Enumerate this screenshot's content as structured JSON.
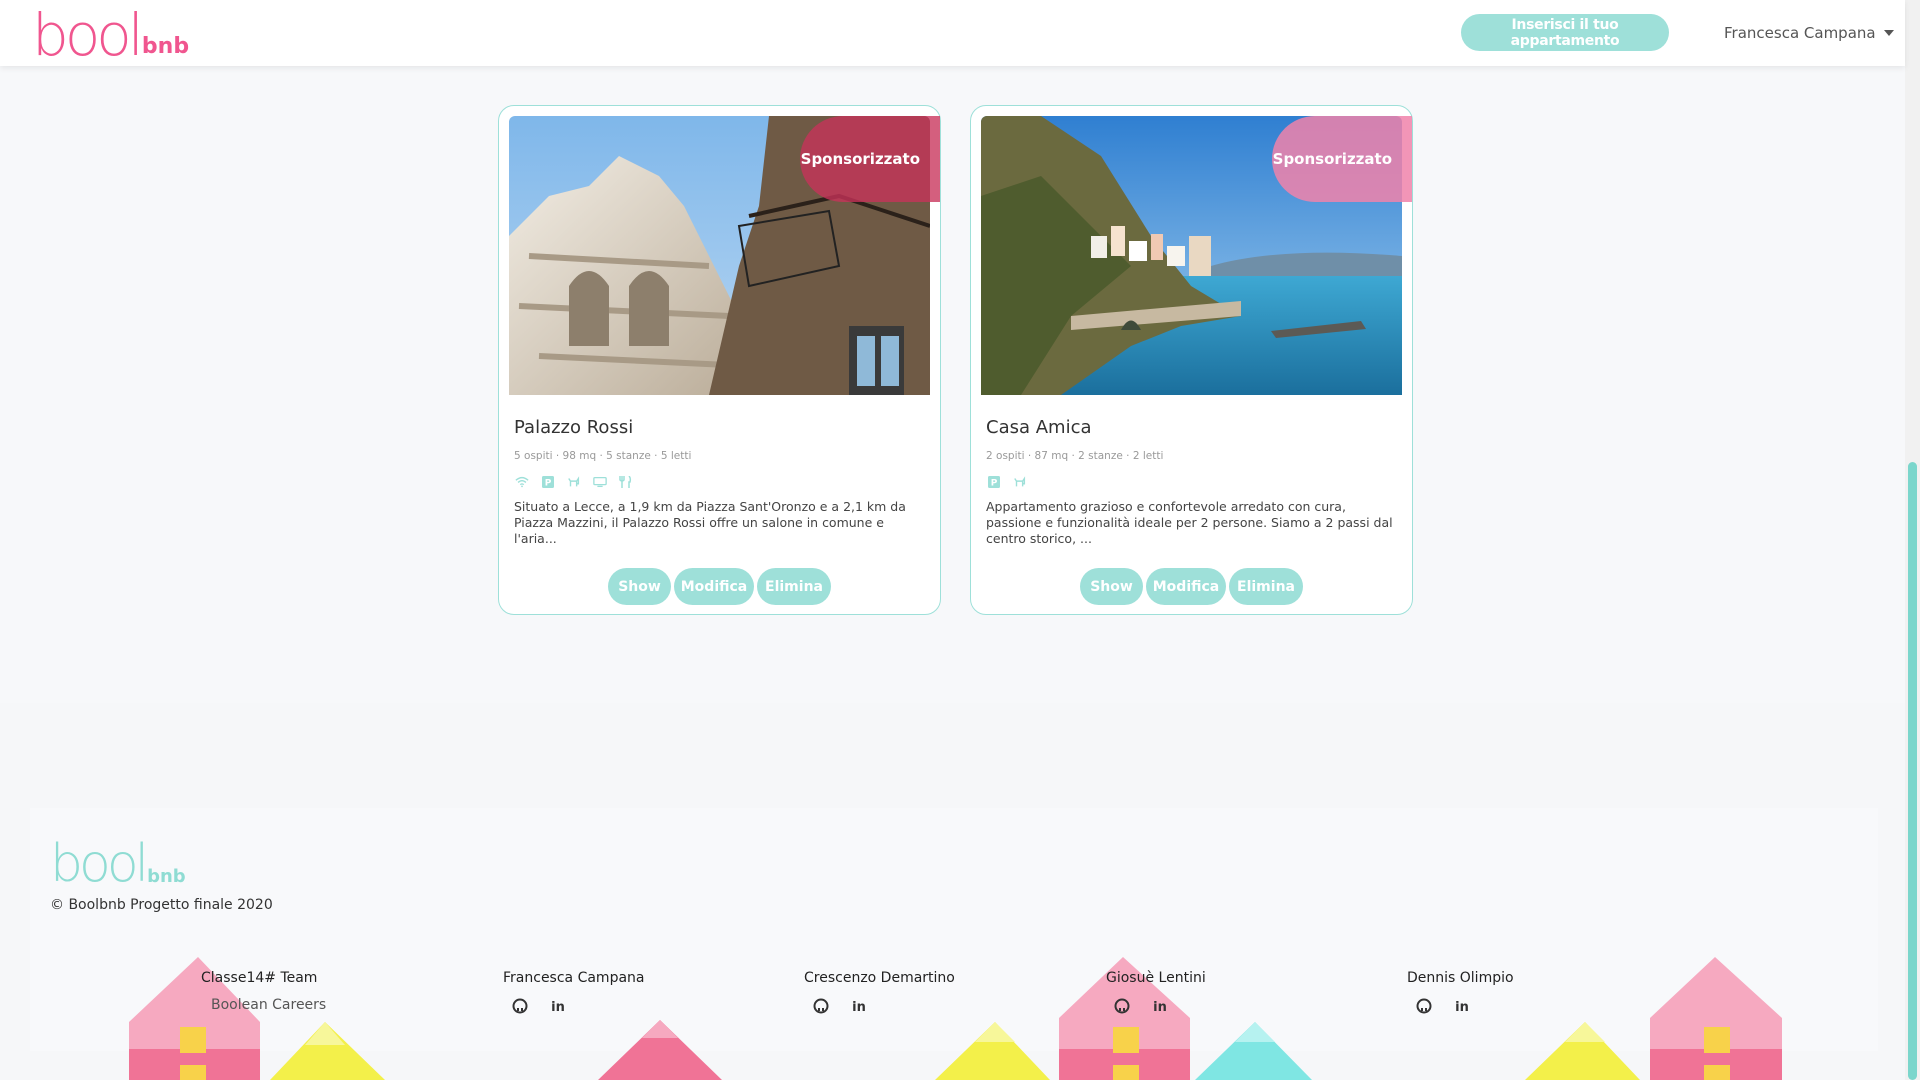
{
  "nav": {
    "logo_big": "bool",
    "logo_small": "bnb",
    "cta_label": "Inserisci il tuo appartamento",
    "user_name": "Francesca Campana"
  },
  "cards": [
    {
      "badge": "Sponsorizzato",
      "title": "Palazzo Rossi",
      "meta": "5 ospiti · 98 mq · 5 stanze · 5 letti",
      "amenities": [
        "wifi-icon",
        "parking-icon",
        "pets-icon",
        "tv-icon",
        "restaurant-icon"
      ],
      "description": "Situato a Lecce, a 1,9 km da Piazza Sant'Oronzo e a 2,1 km da Piazza Mazzini, il Palazzo Rossi offre un salone in comune e l'aria...",
      "actions": [
        "Show",
        "Modifica",
        "Elimina"
      ]
    },
    {
      "badge": "Sponsorizzato",
      "title": "Casa Amica",
      "meta": "2 ospiti · 87 mq · 2 stanze · 2 letti",
      "amenities": [
        "parking-icon",
        "pets-icon"
      ],
      "description": "Appartamento grazioso e confortevole arredato con cura, passione e funzionalità ideale per 2 persone. Siamo a 2 passi dal centro storico, ...",
      "actions": [
        "Show",
        "Modifica",
        "Elimina"
      ]
    }
  ],
  "footer": {
    "logo_big": "bool",
    "logo_small": "bnb",
    "copyright": "© Boolbnb Progetto finale 2020",
    "team": [
      {
        "name": "Classe14# Team",
        "sub": "Boolean Careers"
      },
      {
        "name": "Francesca Campana"
      },
      {
        "name": "Crescenzo Demartino"
      },
      {
        "name": "Giosuè Lentini"
      },
      {
        "name": "Dennis Olimpio"
      }
    ]
  },
  "colors": {
    "brand_pink": "#f0568f",
    "accent_teal": "#9ee0d9"
  }
}
